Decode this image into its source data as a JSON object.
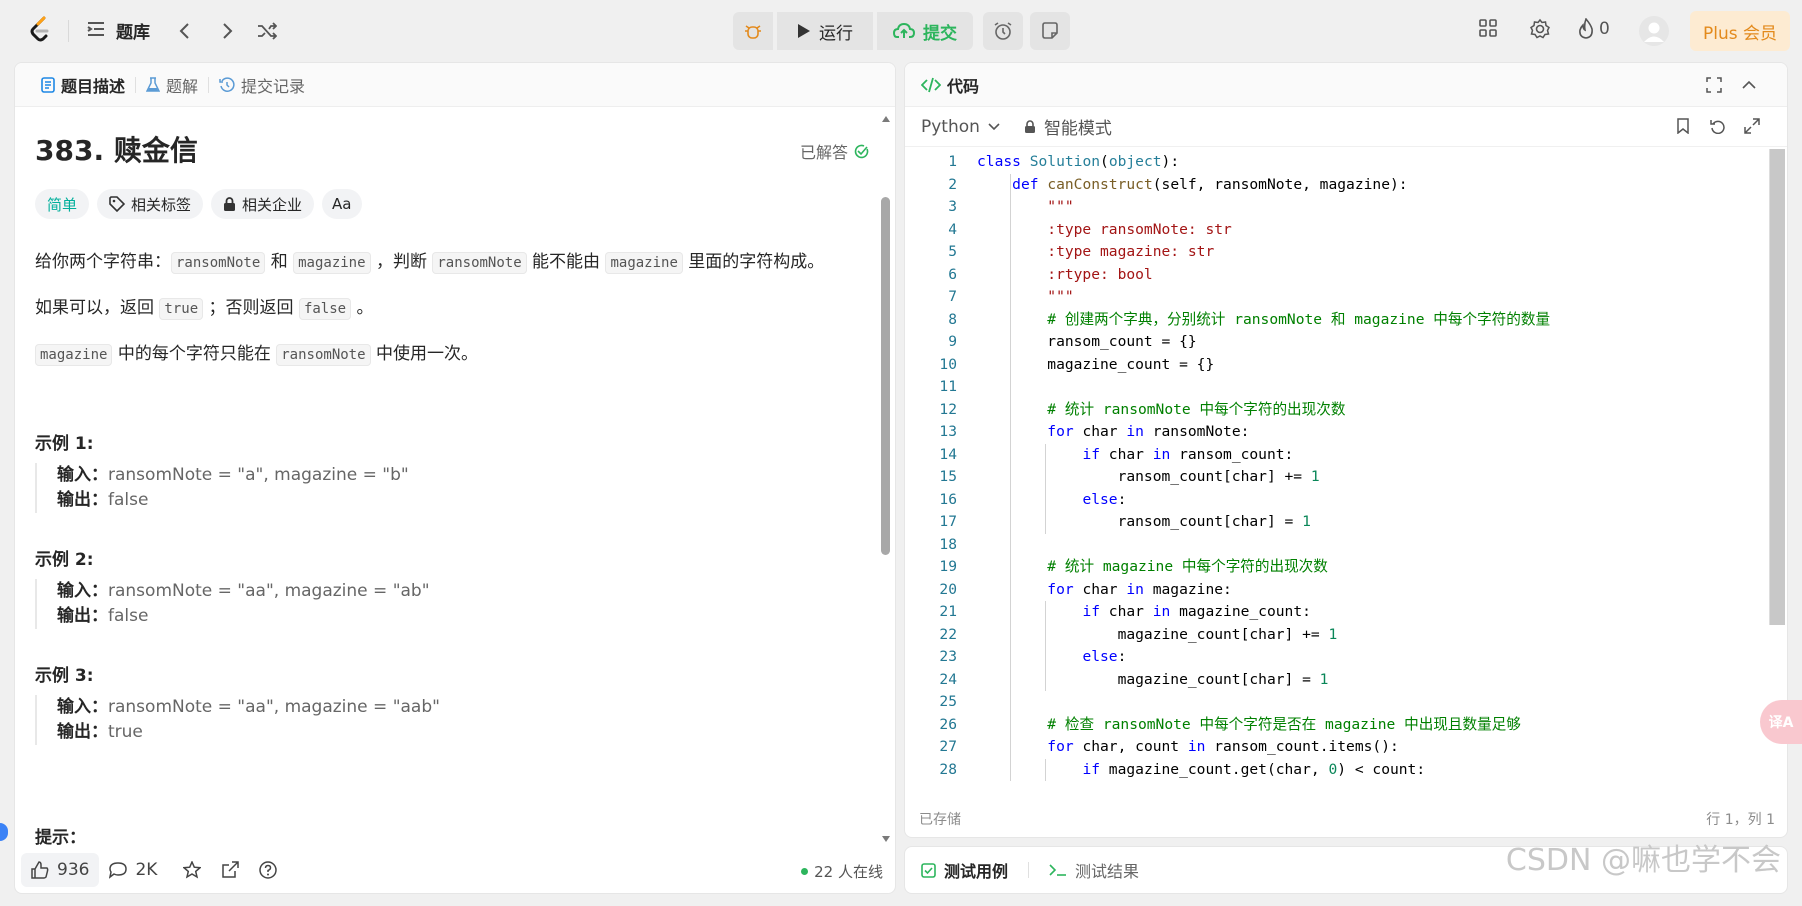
{
  "topbar": {
    "problem_list_label": "题库",
    "run_label": "运行",
    "submit_label": "提交",
    "streak_count": "0",
    "plus_label": "Plus 会员"
  },
  "left": {
    "tabs": [
      {
        "label": "题目描述",
        "active": true
      },
      {
        "label": "题解",
        "active": false
      },
      {
        "label": "提交记录",
        "active": false
      }
    ],
    "title": "383. 赎金信",
    "status": "已解答",
    "chips": {
      "difficulty": "简单",
      "tags": "相关标签",
      "companies": "相关企业",
      "font": "Aa"
    },
    "desc1": {
      "a": "给你两个字符串：",
      "c1": "ransomNote",
      "b": " 和 ",
      "c2": "magazine",
      "c": " ，判断 ",
      "c3": "ransomNote",
      "d": " 能不能由 ",
      "c4": "magazine",
      "e": " 里面的字符构成。"
    },
    "desc2": {
      "a": "如果可以，返回 ",
      "c1": "true",
      "b": " ；否则返回 ",
      "c2": "false",
      "c": " 。"
    },
    "desc3": {
      "c1": "magazine",
      "a": " 中的每个字符只能在 ",
      "c2": "ransomNote",
      "b": " 中使用一次。"
    },
    "examples": [
      {
        "title": "示例 1:",
        "input_label": "输入：",
        "input": "ransomNote = \"a\", magazine = \"b\"",
        "output_label": "输出：",
        "output": "false"
      },
      {
        "title": "示例 2:",
        "input_label": "输入：",
        "input": "ransomNote = \"aa\", magazine = \"ab\"",
        "output_label": "输出：",
        "output": "false"
      },
      {
        "title": "示例 3:",
        "input_label": "输入：",
        "input": "ransomNote = \"aa\", magazine = \"aab\"",
        "output_label": "输出：",
        "output": "true"
      }
    ],
    "hint_title": "提示：",
    "bottom": {
      "likes": "936",
      "comments": "2K",
      "online": "22 人在线"
    }
  },
  "code": {
    "header": "代码",
    "language": "Python",
    "mode": "智能模式",
    "saved": "已存储",
    "position": "行 1，列 1",
    "lines": [
      "class Solution(object):",
      "    def canConstruct(self, ransomNote, magazine):",
      "        \"\"\"",
      "        :type ransomNote: str",
      "        :type magazine: str",
      "        :rtype: bool",
      "        \"\"\"",
      "        # 创建两个字典，分别统计 ransomNote 和 magazine 中每个字符的数量",
      "        ransom_count = {}",
      "        magazine_count = {}",
      "",
      "        # 统计 ransomNote 中每个字符的出现次数",
      "        for char in ransomNote:",
      "            if char in ransom_count:",
      "                ransom_count[char] += 1",
      "            else:",
      "                ransom_count[char] = 1",
      "",
      "        # 统计 magazine 中每个字符的出现次数",
      "        for char in magazine:",
      "            if char in magazine_count:",
      "                magazine_count[char] += 1",
      "            else:",
      "                magazine_count[char] = 1",
      "",
      "        # 检查 ransomNote 中每个字符是否在 magazine 中出现且数量足够",
      "        for char, count in ransom_count.items():",
      "            if magazine_count.get(char, 0) < count:"
    ]
  },
  "test": {
    "tab1": "测试用例",
    "tab2": "测试结果"
  },
  "watermark": "CSDN @嘛也学不会",
  "translate_label": "译A"
}
